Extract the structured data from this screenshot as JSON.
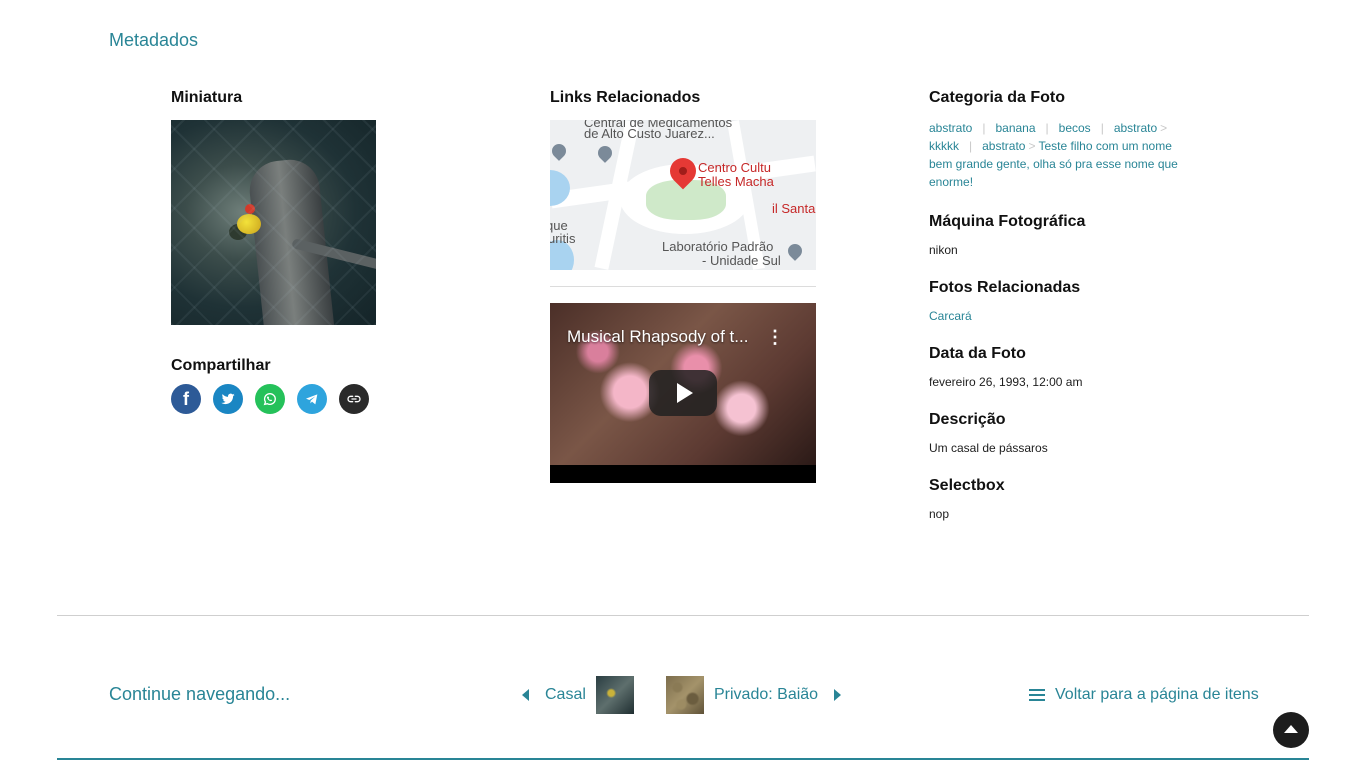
{
  "section": {
    "title": "Metadados"
  },
  "thumbnail": {
    "label": "Miniatura"
  },
  "share": {
    "label": "Compartilhar",
    "buttons": [
      {
        "name": "facebook",
        "color": "#2d5a97",
        "glyph": "f"
      },
      {
        "name": "twitter",
        "color": "#1a86c3",
        "glyph": "t"
      },
      {
        "name": "whatsapp",
        "color": "#25c15a",
        "glyph": "w"
      },
      {
        "name": "telegram",
        "color": "#2ea4dd",
        "glyph": "t"
      },
      {
        "name": "link",
        "color": "#2a2a2a",
        "glyph": "l"
      }
    ]
  },
  "links": {
    "label": "Links Relacionados",
    "map": {
      "place_line1": "Centro Cultu",
      "place_line2": "Telles Macha",
      "top_line1": "Central de Medicamentos",
      "top_line2": "de Alto Custo Juarez...",
      "lab_line1": "Laboratório Padrão",
      "lab_line2": "- Unidade Sul",
      "left_line1": "que",
      "left_line2": "uritis",
      "right_red": "il Santa"
    },
    "video": {
      "title": "Musical Rhapsody of t..."
    }
  },
  "categoria": {
    "label": "Categoria da Foto",
    "items": [
      {
        "text": "abstrato",
        "sep": "|"
      },
      {
        "text": "banana",
        "sep": "|"
      },
      {
        "text": "becos",
        "sep": "|"
      },
      {
        "text": "abstrato",
        "gt": ">"
      },
      {
        "text": "kkkkk",
        "sep": "|"
      },
      {
        "text": "abstrato",
        "gt": ">"
      },
      {
        "text": "Teste filho com um nome bem grande gente, olha só pra esse nome que enorme!"
      }
    ]
  },
  "maquina": {
    "label": "Máquina Fotográfica",
    "value": "nikon"
  },
  "fotos_relacionadas": {
    "label": "Fotos Relacionadas",
    "value": "Carcará"
  },
  "data_foto": {
    "label": "Data da Foto",
    "value": "fevereiro 26, 1993, 12:00 am"
  },
  "descricao": {
    "label": "Descrição",
    "value": "Um casal de pássaros"
  },
  "selectbox": {
    "label": "Selectbox",
    "value": "nop"
  },
  "navigation": {
    "continue": "Continue navegando...",
    "prev": "Casal",
    "next": "Privado: Baião",
    "back": "Voltar para a página de itens"
  },
  "colors": {
    "accent": "#298596",
    "text": "#1d1d1d"
  }
}
